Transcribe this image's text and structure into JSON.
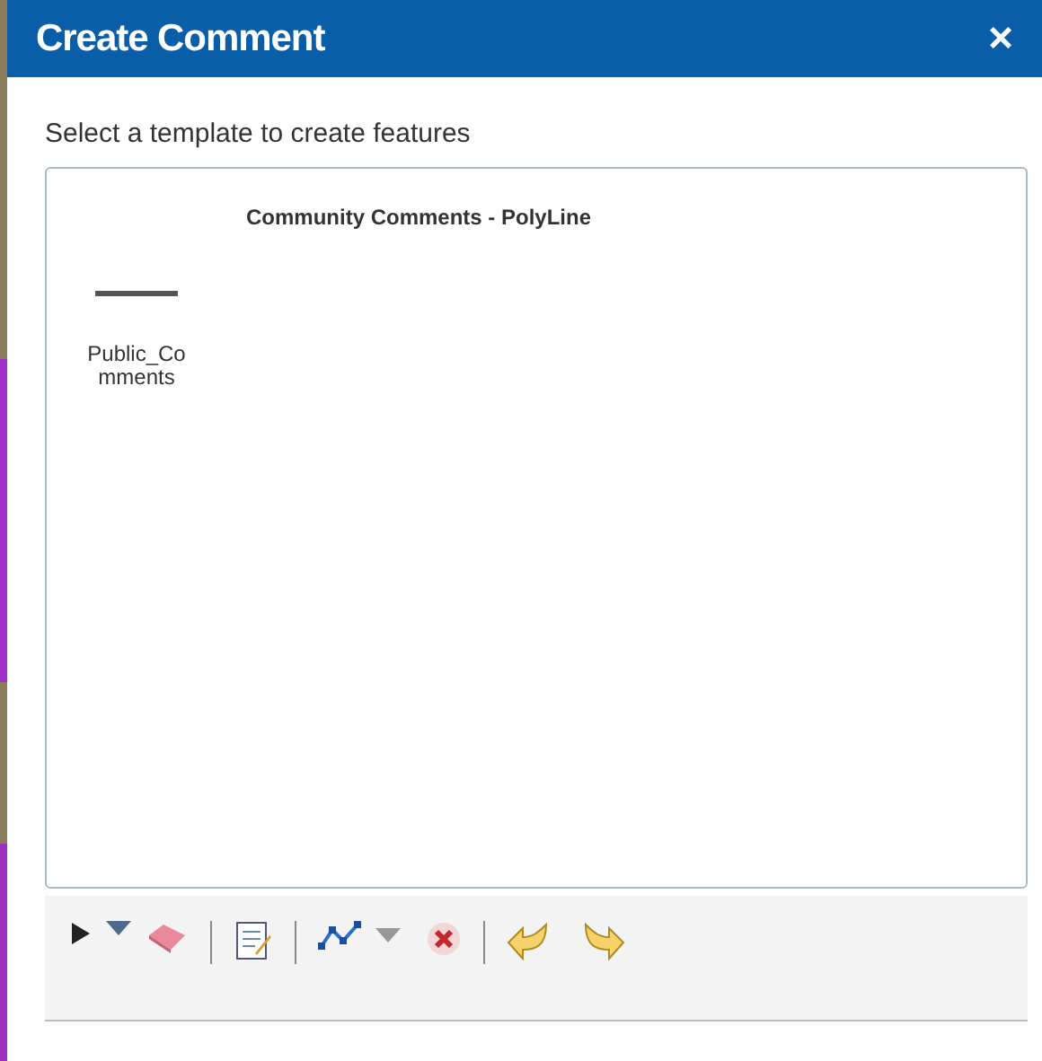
{
  "window": {
    "title": "Create Comment",
    "close": "×"
  },
  "instruction": "Select a template to create features",
  "template_group": {
    "title": "Community Comments - PolyLine",
    "templates": [
      {
        "label": "Public_Comments",
        "selected": false
      }
    ]
  }
}
